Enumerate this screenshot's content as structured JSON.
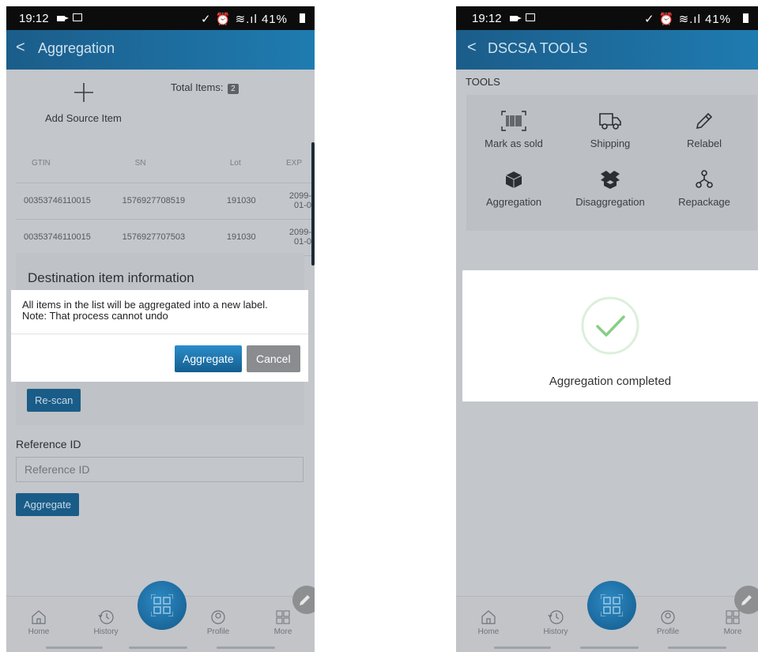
{
  "left": {
    "status": {
      "time": "19:12",
      "system": "✓ ⏰ ≋.ıl 41%"
    },
    "appbar": {
      "back": "<",
      "title": "Aggregation"
    },
    "source": {
      "add_label": "Add Source Item",
      "total_label": "Total Items:",
      "total_count": "2"
    },
    "table": {
      "headers": [
        "GTIN",
        "SN",
        "Lot",
        "EXP"
      ],
      "rows": [
        [
          "00353746110015",
          "1576927708519",
          "191030",
          "2099-01-0"
        ],
        [
          "00353746110015",
          "1576927707503",
          "191030",
          "2099-01-0"
        ]
      ]
    },
    "destination": {
      "title": "Destination item information",
      "rescan_label": "Re-scan"
    },
    "reference": {
      "label": "Reference ID",
      "placeholder": "Reference ID"
    },
    "aggregate_label": "Aggregate",
    "dialog": {
      "line1": "All items in the list will be aggregated into a new label.",
      "line2": "Note: That process cannot undo",
      "confirm_label": "Aggregate",
      "cancel_label": "Cancel"
    }
  },
  "right": {
    "status": {
      "time": "19:12",
      "system": "✓ ⏰ ≋.ıl 41%"
    },
    "appbar": {
      "back": "<",
      "title": "DSCSA TOOLS"
    },
    "section_title": "TOOLS",
    "tools": [
      {
        "label": "Mark as sold",
        "icon": "barcode-icon"
      },
      {
        "label": "Shipping",
        "icon": "truck-icon"
      },
      {
        "label": "Relabel",
        "icon": "pencil-icon"
      },
      {
        "label": "Aggregation",
        "icon": "box-icon"
      },
      {
        "label": "Disaggregation",
        "icon": "open-box-icon"
      },
      {
        "label": "Repackage",
        "icon": "hierarchy-icon"
      }
    ],
    "success": {
      "message": "Aggregation completed"
    }
  },
  "nav": {
    "items": [
      "Home",
      "History",
      "Profile",
      "More"
    ]
  },
  "colors": {
    "appbar": "#1f6fa3",
    "primary": "#1f7bb8",
    "success": "#7ccf7c"
  }
}
